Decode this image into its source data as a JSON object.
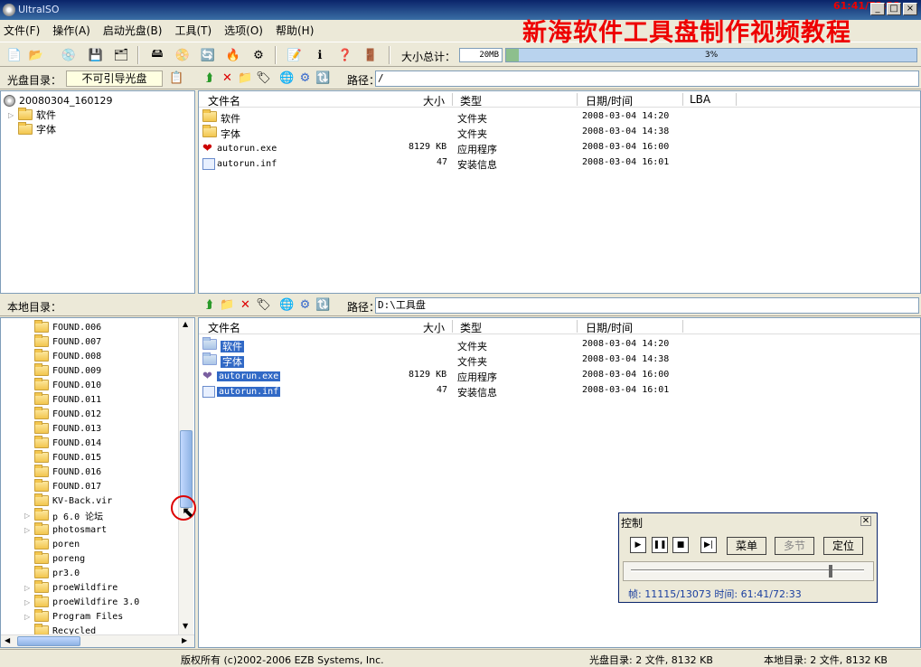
{
  "window": {
    "title": "UltraISO",
    "overlay_title": "新海软件工具盘制作视频教程",
    "timer": "61:41/72:33"
  },
  "window_controls": [
    "_",
    "□",
    "×"
  ],
  "menu": [
    "文件(F)",
    "操作(A)",
    "启动光盘(B)",
    "工具(T)",
    "选项(O)",
    "帮助(H)"
  ],
  "toolbar": {
    "size_label": "大小总计：",
    "size_value": "20MB",
    "progress_text": "3%",
    "progress": 0.03
  },
  "cd_pane": {
    "label": "光盘目录：",
    "boot_status": "不可引导光盘",
    "path_label": "路径：",
    "path": "/"
  },
  "cd_tree": {
    "root": "20080304_160129",
    "items": [
      "软件",
      "字体"
    ]
  },
  "columns": {
    "name": "文件名",
    "size": "大小",
    "type": "类型",
    "date": "日期/时间",
    "lba": "LBA"
  },
  "cd_files": [
    {
      "name": "软件",
      "size": "",
      "type": "文件夹",
      "date": "2008-03-04 14:20"
    },
    {
      "name": "字体",
      "size": "",
      "type": "文件夹",
      "date": "2008-03-04 14:38"
    },
    {
      "name": "autorun.exe",
      "size": "8129 KB",
      "type": "应用程序",
      "date": "2008-03-04 16:00"
    },
    {
      "name": "autorun.inf",
      "size": "47",
      "type": "安装信息",
      "date": "2008-03-04 16:01"
    }
  ],
  "local_pane": {
    "label": "本地目录：",
    "path_label": "路径：",
    "path": "D:\\工具盘"
  },
  "local_tree": [
    {
      "name": "FOUND.006",
      "exp": false
    },
    {
      "name": "FOUND.007",
      "exp": false
    },
    {
      "name": "FOUND.008",
      "exp": false
    },
    {
      "name": "FOUND.009",
      "exp": false
    },
    {
      "name": "FOUND.010",
      "exp": false
    },
    {
      "name": "FOUND.011",
      "exp": false
    },
    {
      "name": "FOUND.012",
      "exp": false
    },
    {
      "name": "FOUND.013",
      "exp": false
    },
    {
      "name": "FOUND.014",
      "exp": false
    },
    {
      "name": "FOUND.015",
      "exp": false
    },
    {
      "name": "FOUND.016",
      "exp": false
    },
    {
      "name": "FOUND.017",
      "exp": false
    },
    {
      "name": "KV-Back.vir",
      "exp": false
    },
    {
      "name": "p 6.0 论坛",
      "exp": true
    },
    {
      "name": "photosmart",
      "exp": true
    },
    {
      "name": "poren",
      "exp": false
    },
    {
      "name": "poreng",
      "exp": false
    },
    {
      "name": "pr3.0",
      "exp": false
    },
    {
      "name": "proeWildfire",
      "exp": true
    },
    {
      "name": "proeWildfire 3.0",
      "exp": true
    },
    {
      "name": "Program Files",
      "exp": true
    },
    {
      "name": "Recycled",
      "exp": false
    }
  ],
  "local_files": [
    {
      "name": "软件",
      "size": "",
      "type": "文件夹",
      "date": "2008-03-04 14:20"
    },
    {
      "name": "字体",
      "size": "",
      "type": "文件夹",
      "date": "2008-03-04 14:38"
    },
    {
      "name": "autorun.exe",
      "size": "8129 KB",
      "type": "应用程序",
      "date": "2008-03-04 16:00"
    },
    {
      "name": "autorun.inf",
      "size": "47",
      "type": "安装信息",
      "date": "2008-03-04 16:01"
    }
  ],
  "status": {
    "copyright": "版权所有 (c)2002-2006 EZB Systems, Inc.",
    "cd_summary": "光盘目录: 2 文件, 8132 KB",
    "local_summary": "本地目录: 2 文件, 8132 KB"
  },
  "control": {
    "title": "控制",
    "menu_btn": "菜单",
    "chapter_btn": "多节",
    "locate_btn": "定位",
    "info": "帧: 11115/13073 时间: 61:41/72:33",
    "position": 0.85
  }
}
